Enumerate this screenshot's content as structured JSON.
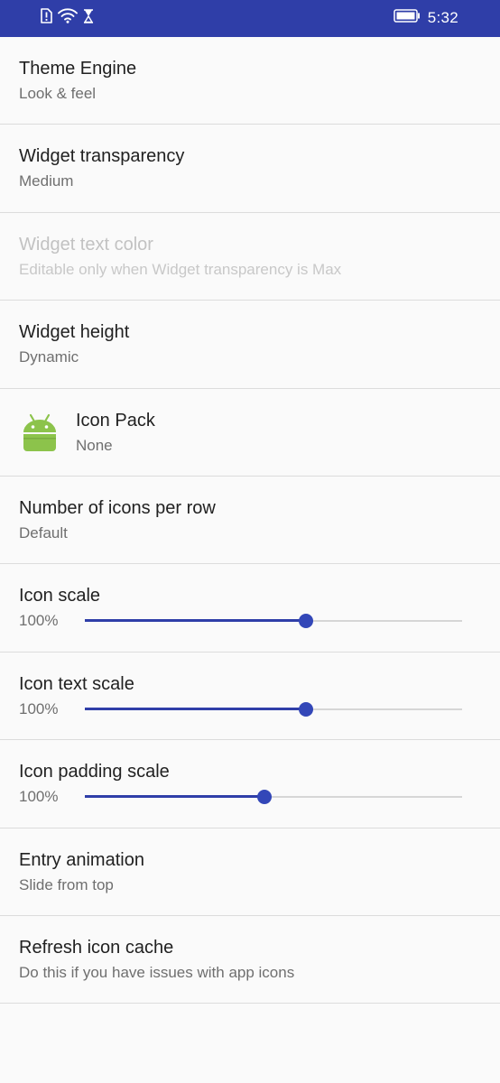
{
  "status_bar": {
    "time": "5:32",
    "icons": [
      "sim-alert-icon",
      "wifi-icon",
      "hourglass-icon",
      "battery-icon"
    ],
    "background_color": "#2f3ea8"
  },
  "settings": {
    "theme_engine": {
      "title": "Theme Engine",
      "summary": "Look & feel"
    },
    "widget_transparency": {
      "title": "Widget transparency",
      "summary": "Medium"
    },
    "widget_text_color": {
      "title": "Widget text color",
      "summary": "Editable only when Widget transparency is Max",
      "enabled": false
    },
    "widget_height": {
      "title": "Widget height",
      "summary": "Dynamic"
    },
    "icon_pack": {
      "title": "Icon Pack",
      "summary": "None",
      "icon": "android-icon",
      "icon_color": "#8cc34b"
    },
    "icons_per_row": {
      "title": "Number of icons per row",
      "summary": "Default"
    },
    "icon_scale": {
      "title": "Icon scale",
      "value_label": "100%",
      "slider_fraction": 0.585
    },
    "icon_text_scale": {
      "title": "Icon text scale",
      "value_label": "100%",
      "slider_fraction": 0.585
    },
    "icon_padding_scale": {
      "title": "Icon padding scale",
      "value_label": "100%",
      "slider_fraction": 0.475
    },
    "entry_animation": {
      "title": "Entry animation",
      "summary": "Slide from top"
    },
    "refresh_icon_cache": {
      "title": "Refresh icon cache",
      "summary": "Do this if you have issues with app icons"
    }
  },
  "colors": {
    "accent": "#3347b8",
    "title_text": "#212121",
    "summary_text": "#6f6f6f",
    "disabled_text": "#c2c2c2",
    "divider": "#dcdcdc",
    "background": "#fafafa"
  }
}
